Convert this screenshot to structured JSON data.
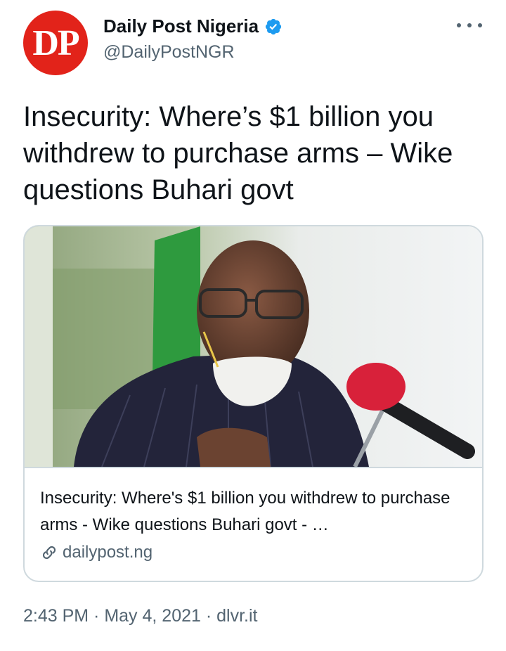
{
  "tweet": {
    "author": {
      "display_name": "Daily Post Nigeria",
      "handle": "@DailyPostNGR",
      "avatar_text": "DP",
      "verified": true
    },
    "text": "Insecurity: Where’s $1 billion you withdrew to purchase arms – Wike questions Buhari govt",
    "card": {
      "title": "Insecurity: Where's $1 billion you withdrew to purchase arms - Wike questions Buhari govt - …",
      "domain": "dailypost.ng",
      "image_icon": "news-photo-man-with-face-mask-at-microphone"
    },
    "meta": {
      "time": "2:43 PM",
      "separator": " · ",
      "date": "May 4, 2021",
      "source": "dlvr.it"
    }
  },
  "icons": {
    "verified": "verified-badge-icon",
    "more": "more-options-icon",
    "link": "link-icon"
  },
  "colors": {
    "brand_red": "#e2231a",
    "verified_blue": "#1d9bf0",
    "secondary_text": "#536471",
    "border": "#cfd9de"
  }
}
